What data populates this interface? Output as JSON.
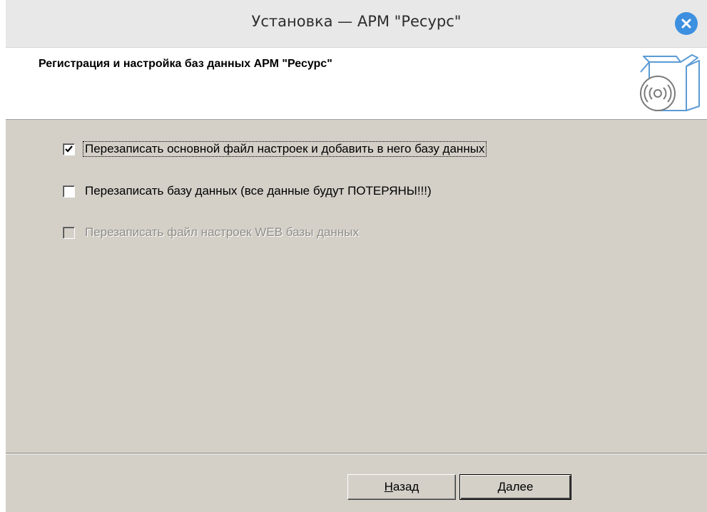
{
  "window": {
    "title": "Установка — АРМ \"Ресурс\""
  },
  "header": {
    "title": "Регистрация и настройка баз данных АРМ \"Ресурс\"",
    "icon": "installer-box-disc-icon"
  },
  "options": [
    {
      "label": "Перезаписать основной файл настроек и добавить в него базу данных",
      "checked": true,
      "enabled": true,
      "focused": true
    },
    {
      "label": "Перезаписать базу данных (все данные будут ПОТЕРЯНЫ!!!)",
      "checked": false,
      "enabled": true,
      "focused": false
    },
    {
      "label": "Перезаписать файл настроек WEB базы данных",
      "checked": false,
      "enabled": false,
      "focused": false
    }
  ],
  "buttons": {
    "back": {
      "mnemonic": "Н",
      "rest": "азад"
    },
    "next": {
      "mnemonic": "Д",
      "rest": "алее"
    }
  },
  "colors": {
    "panel": "#d4d0c8",
    "header_bg": "#ffffff",
    "titlebar_bg": "#e8e8e8",
    "close_button": "#3d8fe0",
    "icon_stroke": "#5b9bd5",
    "disabled_text": "#8f8d88"
  }
}
